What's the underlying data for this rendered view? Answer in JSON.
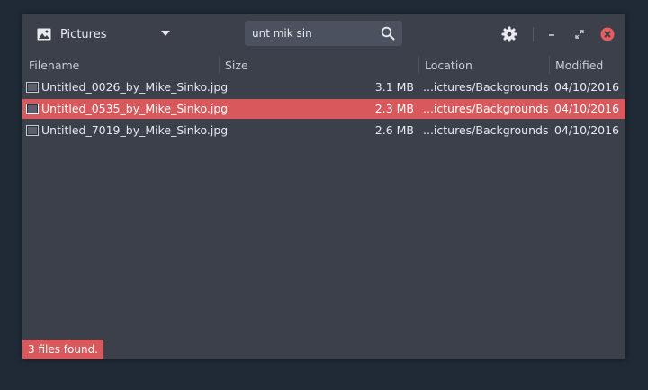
{
  "toolbar": {
    "place_label": "Pictures",
    "search_value": "unt mik sin",
    "icons": {
      "place": "image-icon",
      "dropdown": "chevron-down-icon",
      "search": "search-icon",
      "settings": "gear-icon",
      "minimize": "minimize-icon",
      "restore": "restore-icon",
      "close": "close-icon"
    }
  },
  "table": {
    "columns": [
      "Filename",
      "Size",
      "Location",
      "Modified"
    ],
    "rows": [
      {
        "name": "Untitled_0026_by_Mike_Sinko.jpg",
        "size": "3.1 MB",
        "location": "...ictures/Backgrounds",
        "modified": "04/10/2016",
        "selected": false
      },
      {
        "name": "Untitled_0535_by_Mike_Sinko.jpg",
        "size": "2.3 MB",
        "location": "...ictures/Backgrounds",
        "modified": "04/10/2016",
        "selected": true
      },
      {
        "name": "Untitled_7019_by_Mike_Sinko.jpg",
        "size": "2.6 MB",
        "location": "...ictures/Backgrounds",
        "modified": "04/10/2016",
        "selected": false
      }
    ]
  },
  "status": "3 files found.",
  "colors": {
    "accent": "#d9585b",
    "window_bg": "#3b404b",
    "desktop_bg": "#1f2a36",
    "close_button": "#e85c5c"
  }
}
